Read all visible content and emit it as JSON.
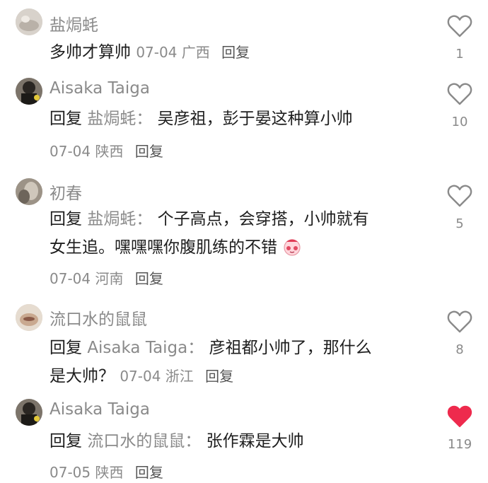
{
  "comments": [
    {
      "username": "盐焗蚝",
      "text": "多帅才算帅",
      "date": "07-04",
      "location": "广西",
      "reply_label": "回复",
      "likes": "1",
      "liked": false
    },
    {
      "username": "Aisaka Taiga",
      "reply_prefix": "回复",
      "reply_to": "盐焗蚝：",
      "text": "吴彦祖，彭于晏这种算小帅",
      "date": "07-04",
      "location": "陕西",
      "reply_label": "回复",
      "likes": "10",
      "liked": false
    },
    {
      "username": "初春",
      "reply_prefix": "回复",
      "reply_to": "盐焗蚝：",
      "text": "个子高点，会穿搭，小帅就有",
      "text2": "女生追。嘿嘿嘿你腹肌练的不错",
      "date": "07-04",
      "location": "河南",
      "reply_label": "回复",
      "likes": "5",
      "liked": false
    },
    {
      "username": "流口水的鼠鼠",
      "reply_prefix": "回复",
      "reply_to": "Aisaka Taiga：",
      "text": "彦祖都小帅了，那什么",
      "text2": "是大帅？",
      "date": "07-04",
      "location": "浙江",
      "reply_label": "回复",
      "likes": "8",
      "liked": false
    },
    {
      "username": "Aisaka Taiga",
      "reply_prefix": "回复",
      "reply_to": "流口水的鼠鼠：",
      "text": "张作霖是大帅",
      "date": "07-05",
      "location": "陕西",
      "reply_label": "回复",
      "likes": "119",
      "liked": true
    }
  ],
  "colors": {
    "username": "#8a8a8a",
    "text": "#1e1e1e",
    "liked_heart": "#ee2a4d",
    "unliked_heart": "#8a8a8a"
  },
  "icons": {
    "like": "heart-outline-icon",
    "liked": "heart-filled-icon",
    "emoji": "blush-face-icon"
  }
}
